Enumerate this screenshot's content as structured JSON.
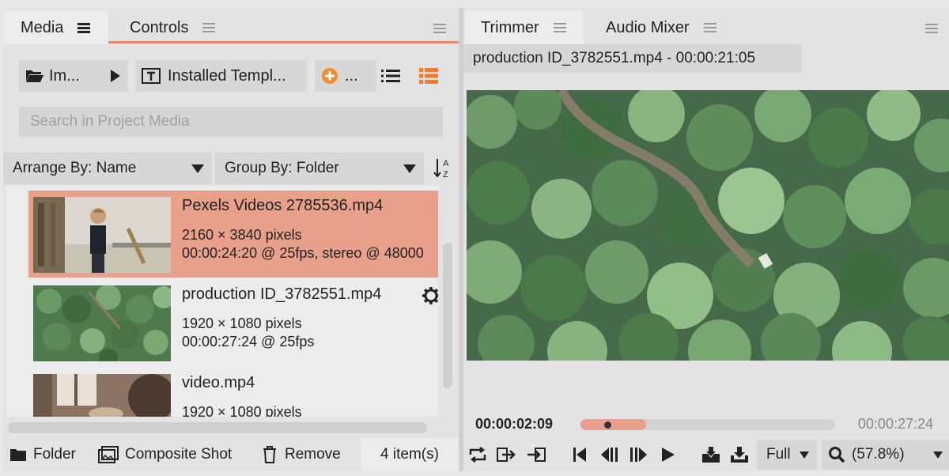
{
  "left_panel": {
    "tabs": [
      {
        "label": "Media",
        "active": true
      },
      {
        "label": "Controls",
        "active": false
      }
    ],
    "toolbar": {
      "import_label": "Im...",
      "templates_label": "Installed Templ...",
      "add_label": "...",
      "accent_color": "#f28a30"
    },
    "search": {
      "placeholder": "Search in Project Media"
    },
    "arrange": {
      "label": "Arrange By: Name"
    },
    "group": {
      "label": "Group By: Folder"
    },
    "items": [
      {
        "name": "Pexels Videos 2785536.mp4",
        "dims": "2160 × 3840 pixels",
        "meta": "00:00:24:20 @ 25fps, stereo @ 48000",
        "selected": true
      },
      {
        "name": "production ID_3782551.mp4",
        "dims": "1920 × 1080 pixels",
        "meta": "00:00:27:24 @ 25fps",
        "selected": false
      },
      {
        "name": "video.mp4",
        "dims": "1920 × 1080 pixels",
        "meta": "",
        "selected": false
      }
    ],
    "bottom": {
      "folder_label": "Folder",
      "composite_label": "Composite Shot",
      "remove_label": "Remove",
      "count_label": "4 item(s)"
    }
  },
  "right_panel": {
    "tabs": [
      {
        "label": "Trimmer",
        "active": true
      },
      {
        "label": "Audio Mixer",
        "active": false
      }
    ],
    "file_title": "production ID_3782551.mp4 - 00:00:21:05",
    "current_time": "00:00:02:09",
    "duration": "00:00:27:24",
    "playhead_fraction": 0.09,
    "quality": "Full",
    "zoom": "(57.8%)"
  },
  "colors": {
    "accent": "#e8896c",
    "selection": "#e8a08a"
  }
}
